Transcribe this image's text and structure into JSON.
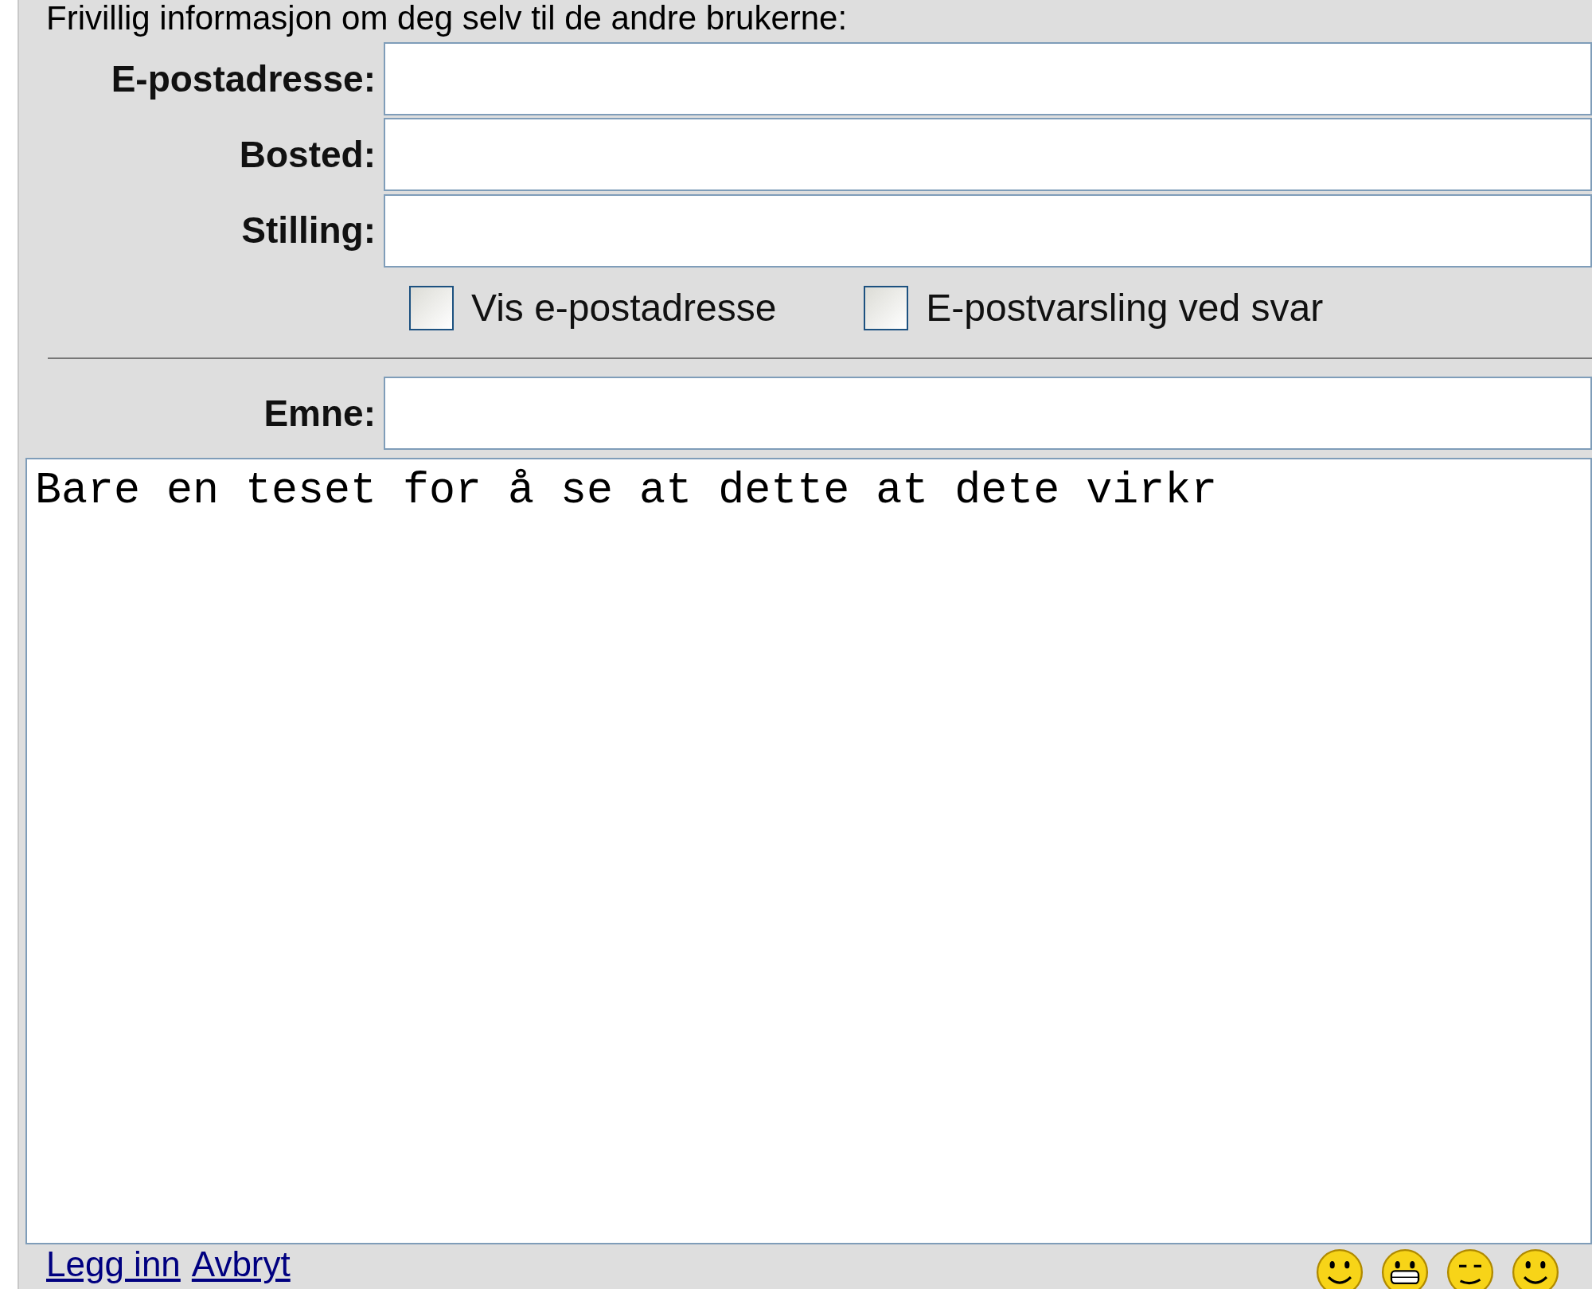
{
  "intro": "Frivillig informasjon om deg selv til de andre brukerne:",
  "fields": [
    {
      "label": "E-postadresse:"
    },
    {
      "label": "Bosted:"
    },
    {
      "label": "Stilling:"
    }
  ],
  "checkboxes": [
    {
      "label": "Vis e-postadresse",
      "checked": false
    },
    {
      "label": "E-postvarsling ved svar",
      "checked": false
    }
  ],
  "subject": {
    "label": "Emne:"
  },
  "message": {
    "value": "Bare en teset for å se at dette at dete virkr"
  },
  "links": [
    "Legg inn",
    "Avbryt"
  ],
  "emoticons": [
    {
      "kind": "smile"
    },
    {
      "kind": "grin"
    },
    {
      "kind": "squint"
    },
    {
      "kind": "smile"
    }
  ]
}
